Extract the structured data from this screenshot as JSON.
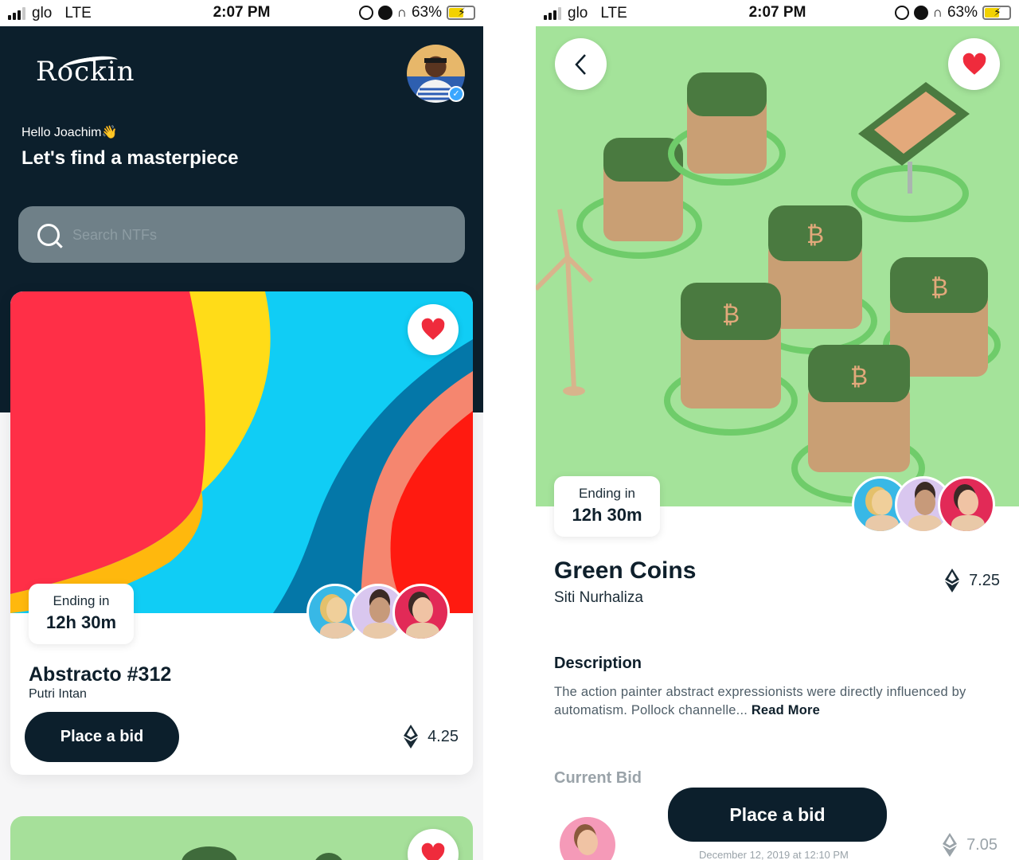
{
  "status_bar": {
    "carrier": "glo",
    "network": "LTE",
    "time": "2:07 PM",
    "battery": "63%"
  },
  "home": {
    "logo_text": "Rockin",
    "greeting": "Hello Joachim👋",
    "headline": "Let's find a masterpiece",
    "search_placeholder": "Search NTFs",
    "card": {
      "ending_label": "Ending in",
      "ending_time": "12h 30m",
      "title": "Abstracto #312",
      "artist": "Putri Intan",
      "bid_button": "Place a bid",
      "price": "4.25"
    }
  },
  "detail": {
    "ending_label": "Ending in",
    "ending_time": "12h 30m",
    "title": "Green Coins",
    "artist": "Siti Nurhaliza",
    "price": "7.25",
    "description_heading": "Description",
    "description_text": "The action painter abstract expressionists were directly influenced by automatism. Pollock channelle... ",
    "read_more": "Read More",
    "current_bid_heading": "Current Bid",
    "bid_date": "December 12, 2019 at 12:10 PM",
    "bid_price": "7.05",
    "bid_button": "Place a bid"
  },
  "colors": {
    "navy": "#0c1f2c",
    "heart_red": "#ef2b3c",
    "mint_green": "#a4e39a",
    "search_grey": "#6f8088"
  },
  "icons": [
    "search-icon",
    "heart-icon",
    "back-arrow-icon",
    "ethereum-icon",
    "verified-badge-icon"
  ]
}
